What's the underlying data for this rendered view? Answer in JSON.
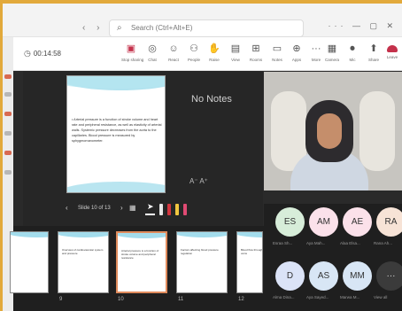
{
  "colors": {
    "accent": "#e2a93b",
    "leave": "#c4314b",
    "stage": "#2a2a2a",
    "avatar_es": "#d7edd9",
    "avatar_am": "#fbe1ea",
    "avatar_ae": "#fbe1ea",
    "avatar_ra": "#f7e3d6",
    "avatar_d": "#dbe3f7",
    "avatar_as": "#d8e6f5",
    "avatar_mm": "#d8e6f5",
    "avatar_more": "#3b3b3b"
  },
  "titlebar": {
    "search_text": "Search (Ctrl+Alt+E)",
    "search_icon": "search-icon",
    "window_controls": "··· — ▢ ✕"
  },
  "toolbar": {
    "timer": "00:14:58",
    "items": [
      {
        "icon": "stop-presenting-icon",
        "glyph": "▣",
        "label": "Stop sharing"
      },
      {
        "icon": "chat-icon",
        "glyph": "◎",
        "label": "Chat"
      },
      {
        "icon": "react-icon",
        "glyph": "☺",
        "label": "React"
      },
      {
        "icon": "people-icon",
        "glyph": "⚇",
        "label": "People"
      },
      {
        "icon": "raise-hand-icon",
        "glyph": "✋",
        "label": "Raise"
      },
      {
        "icon": "view-icon",
        "glyph": "▤",
        "label": "View"
      },
      {
        "icon": "rooms-icon",
        "glyph": "⊞",
        "label": "Rooms"
      },
      {
        "icon": "notes-icon",
        "glyph": "▭",
        "label": "Notes"
      },
      {
        "icon": "apps-icon",
        "glyph": "⊕",
        "label": "Apps"
      },
      {
        "icon": "more-icon",
        "glyph": "···",
        "label": "More"
      },
      {
        "icon": "camera-icon",
        "glyph": "▦",
        "label": "Camera"
      },
      {
        "icon": "mic-icon",
        "glyph": "⏺",
        "label": "Mic"
      },
      {
        "icon": "share-icon",
        "glyph": "⬆",
        "label": "Share"
      }
    ],
    "leave_label": "Leave"
  },
  "presenter": {
    "slide_text": "• Arterial pressure is a function of stroke volume and heart rate and peripheral resistance, as well as elasticity of arterial walls. Systemic pressure decreases from the aorta to the capillaries. Blood pressure is measured by sphygmomanometer.",
    "no_notes": "No Notes",
    "font_size": "A⁻  A⁺",
    "counter": "Slide 10 of 13",
    "prev": "‹",
    "next": "›",
    "laser": "⌖",
    "grid": "▦"
  },
  "filmstrip": [
    {
      "num": "9",
      "lines": "Overview of cardiovascular system and pressure"
    },
    {
      "num": "10",
      "lines": "Arterial pressure is a function of stroke volume and peripheral resistance"
    },
    {
      "num": "11",
      "lines": "Factors affecting blood pressure regulation"
    },
    {
      "num": "12",
      "lines": "Blood flow through capillaries and veins"
    }
  ],
  "people": [
    {
      "initials": "ES",
      "name": "Esraa Sh..."
    },
    {
      "initials": "AM",
      "name": "Aya Mah..."
    },
    {
      "initials": "AE",
      "name": "Alaa Elsa..."
    },
    {
      "initials": "RA",
      "name": "Rana Ah..."
    },
    {
      "initials": "D",
      "name": "Alma Dina..."
    },
    {
      "initials": "AS",
      "name": "Aya Sayed..."
    },
    {
      "initials": "MM",
      "name": "Marwa M..."
    },
    {
      "initials": "···",
      "name": "View all"
    }
  ]
}
